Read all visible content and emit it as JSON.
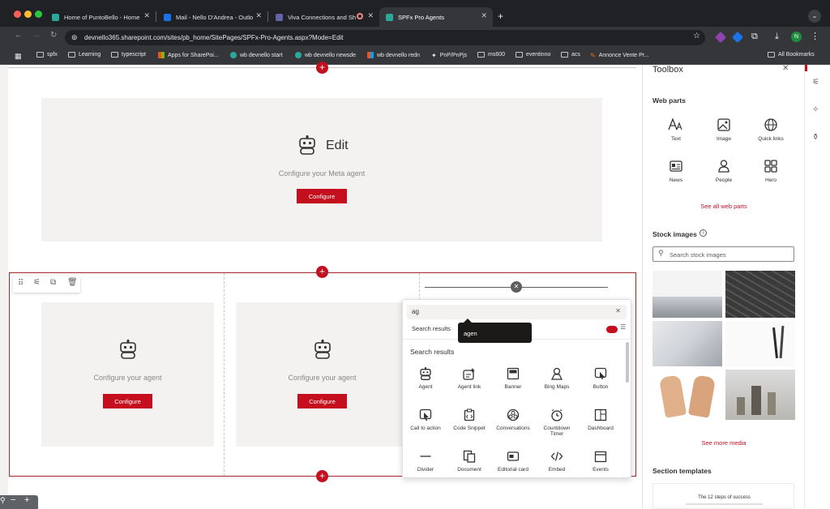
{
  "browser": {
    "tabs": [
      {
        "label": "Home of PuntoBello - Home",
        "color": "#2aa89a"
      },
      {
        "label": "Mail - Nello D'Andrea - Outlo",
        "color": "#1a73e8"
      },
      {
        "label": "Viva Connections and Sh",
        "color": "#6264a7"
      },
      {
        "label": "SPFx Pro Agents",
        "color": "#2aa89a"
      }
    ],
    "new_tab": "+",
    "url": "devnello365.sharepoint.com/sites/pb_home/SitePages/SPFx-Pro-Agents.aspx?Mode=Edit",
    "profile_initial": "N",
    "bookmarks": [
      "spfx",
      "Learning",
      "typescript",
      "Apps for SharePoi...",
      "wb devnello start",
      "wb devnello newsde",
      "wb devnello redn",
      "PnP/PnPjs",
      "ms600",
      "eventinno",
      "acs",
      "Annonce Vente Pr..."
    ],
    "all_bookmarks": "All Bookmarks"
  },
  "canvas": {
    "top_agent": {
      "title": "Edit",
      "subtitle": "Configure your Meta agent",
      "button": "Configure"
    },
    "agent_left": {
      "subtitle": "Configure your agent",
      "button": "Configure"
    },
    "agent_mid": {
      "subtitle": "Configure your agent",
      "button": "Configure"
    },
    "add_symbol": "+"
  },
  "picker": {
    "search_value": "ag",
    "results_label": "Search results",
    "tooltip": "agen",
    "section_heading": "Search results",
    "items": [
      "Agent",
      "Agent link",
      "Banner",
      "Bing Maps",
      "Button",
      "Call to action",
      "Code Snippet",
      "Conversations",
      "Countdown Timer",
      "Dashboard",
      "Divider",
      "Document",
      "Editorial card",
      "Embed",
      "Events"
    ]
  },
  "toolbox": {
    "title": "Toolbox",
    "web_parts_heading": "Web parts",
    "web_parts": [
      "Text",
      "Image",
      "Quick links",
      "News",
      "People",
      "Hero"
    ],
    "see_all": "See all web parts",
    "stock_heading": "Stock images",
    "stock_search_placeholder": "Search stock images",
    "see_more": "See more media",
    "templates_heading": "Section templates",
    "template_title": "The 12 steps of success"
  },
  "colors": {
    "accent": "#c50f1f",
    "chrome_dark": "#202124",
    "chrome_mid": "#35363a"
  }
}
